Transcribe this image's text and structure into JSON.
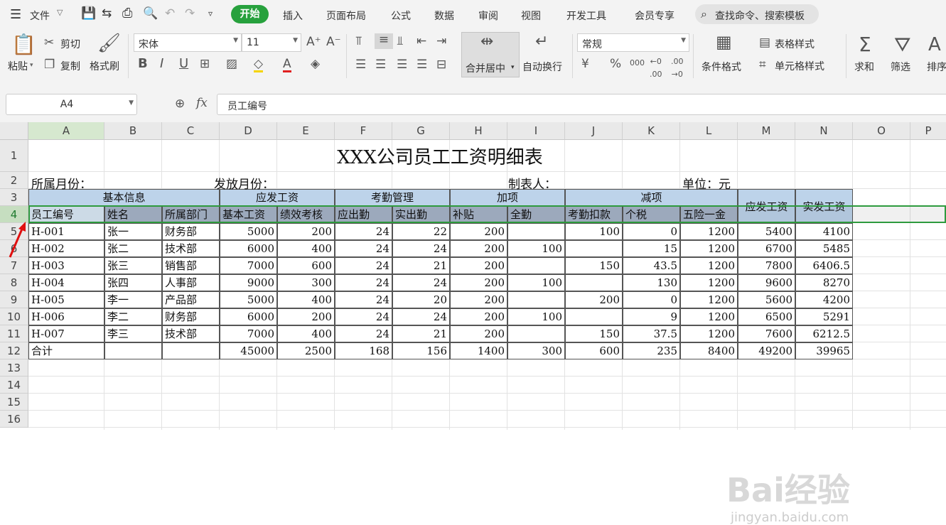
{
  "menubar": {
    "file": "文件",
    "tabs": [
      "开始",
      "插入",
      "页面布局",
      "公式",
      "数据",
      "审阅",
      "视图",
      "开发工具",
      "会员专享"
    ],
    "search_placeholder": "查找命令、搜索模板"
  },
  "ribbon": {
    "paste": "粘贴",
    "cut": "剪切",
    "copy": "复制",
    "format_painter": "格式刷",
    "font_name": "宋体",
    "font_size": "11",
    "merge_center": "合并居中",
    "wrap_text": "自动换行",
    "number_format": "常规",
    "conditional_format": "条件格式",
    "table_style": "表格样式",
    "cell_style": "单元格样式",
    "sum": "求和",
    "filter": "筛选",
    "sort": "排序"
  },
  "formula_bar": {
    "name_box": "A4",
    "fx_label": "fx",
    "content": "员工编号"
  },
  "columns": [
    "A",
    "B",
    "C",
    "D",
    "E",
    "F",
    "G",
    "H",
    "I",
    "J",
    "K",
    "L",
    "M",
    "N",
    "O",
    "P"
  ],
  "rows": [
    "1",
    "2",
    "3",
    "4",
    "5",
    "6",
    "7",
    "8",
    "9",
    "10",
    "11",
    "12",
    "13",
    "14",
    "15",
    "16"
  ],
  "sheet": {
    "title": "XXX公司员工工资明细表",
    "info": {
      "belong_month": "所属月份：",
      "issue_month": "发放月份：",
      "maker": "制表人：",
      "unit": "单位：元"
    },
    "groups": [
      "基本信息",
      "应发工资",
      "考勤管理",
      "加项",
      "减项",
      "应发工资",
      "实发工资"
    ],
    "headers": [
      "员工编号",
      "姓名",
      "所属部门",
      "基本工资",
      "绩效考核",
      "应出勤",
      "实出勤",
      "补贴",
      "全勤",
      "考勤扣款",
      "个税",
      "五险一金"
    ],
    "data": [
      [
        "H-001",
        "张一",
        "财务部",
        "5000",
        "200",
        "24",
        "22",
        "200",
        "",
        "100",
        "0",
        "1200",
        "5400",
        "4100"
      ],
      [
        "H-002",
        "张二",
        "技术部",
        "6000",
        "400",
        "24",
        "24",
        "200",
        "100",
        "",
        "15",
        "1200",
        "6700",
        "5485"
      ],
      [
        "H-003",
        "张三",
        "销售部",
        "7000",
        "600",
        "24",
        "21",
        "200",
        "",
        "150",
        "43.5",
        "1200",
        "7800",
        "6406.5"
      ],
      [
        "H-004",
        "张四",
        "人事部",
        "9000",
        "300",
        "24",
        "24",
        "200",
        "100",
        "",
        "130",
        "1200",
        "9600",
        "8270"
      ],
      [
        "H-005",
        "李一",
        "产品部",
        "5000",
        "400",
        "24",
        "20",
        "200",
        "",
        "200",
        "0",
        "1200",
        "5600",
        "4200"
      ],
      [
        "H-006",
        "李二",
        "财务部",
        "6000",
        "200",
        "24",
        "24",
        "200",
        "100",
        "",
        "9",
        "1200",
        "6500",
        "5291"
      ],
      [
        "H-007",
        "李三",
        "技术部",
        "7000",
        "400",
        "24",
        "21",
        "200",
        "",
        "150",
        "37.5",
        "1200",
        "7600",
        "6212.5"
      ]
    ],
    "total": [
      "合计",
      "",
      "",
      "45000",
      "2500",
      "168",
      "156",
      "1400",
      "300",
      "600",
      "235",
      "8400",
      "49200",
      "39965"
    ]
  },
  "watermark": {
    "brand": "Bai经验",
    "url": "jingyan.baidu.com"
  }
}
